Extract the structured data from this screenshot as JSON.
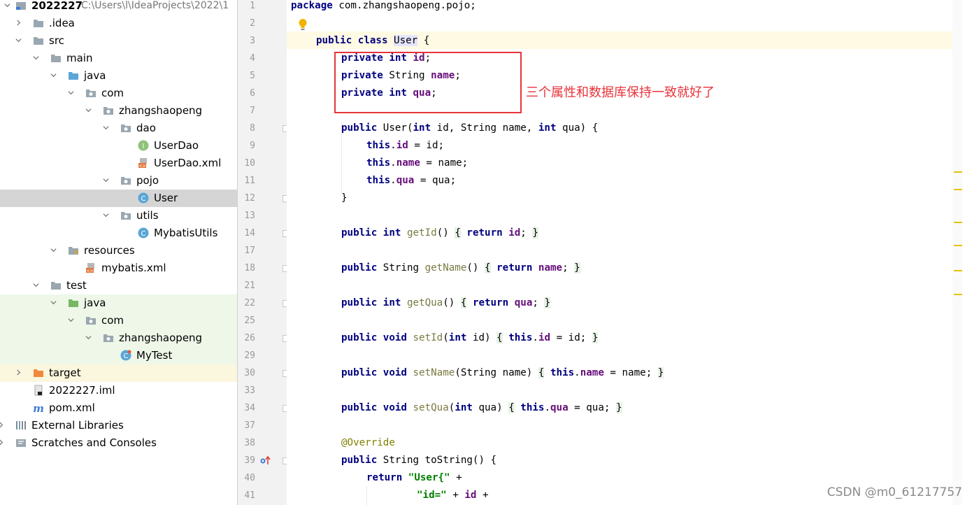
{
  "project_tree": {
    "root": {
      "label": "2022227",
      "path": "C:\\Users\\l\\IdeaProjects\\2022\\1"
    },
    "items": [
      {
        "label": ".idea"
      },
      {
        "label": "src"
      },
      {
        "label": "main"
      },
      {
        "label": "java"
      },
      {
        "label": "com"
      },
      {
        "label": "zhangshaopeng"
      },
      {
        "label": "dao"
      },
      {
        "label": "UserDao"
      },
      {
        "label": "UserDao.xml"
      },
      {
        "label": "pojo"
      },
      {
        "label": "User"
      },
      {
        "label": "utils"
      },
      {
        "label": "MybatisUtils"
      },
      {
        "label": "resources"
      },
      {
        "label": "mybatis.xml"
      },
      {
        "label": "test"
      },
      {
        "label": "java"
      },
      {
        "label": "com"
      },
      {
        "label": "zhangshaopeng"
      },
      {
        "label": "MyTest"
      },
      {
        "label": "target"
      },
      {
        "label": "2022227.iml"
      },
      {
        "label": "pom.xml"
      },
      {
        "label": "External Libraries"
      },
      {
        "label": "Scratches and Consoles"
      }
    ]
  },
  "editor": {
    "line_numbers": [
      "1",
      "2",
      "3",
      "4",
      "5",
      "6",
      "7",
      "8",
      "9",
      "10",
      "11",
      "12",
      "13",
      "14",
      "17",
      "18",
      "21",
      "22",
      "25",
      "26",
      "29",
      "30",
      "33",
      "34",
      "37",
      "38",
      "39",
      "40",
      "41"
    ],
    "code": {
      "l1": {
        "kw": "package",
        "rest": " com.zhangshaopeng.pojo;"
      },
      "l3": {
        "kw1": "public class",
        "name": "User",
        "rest": " {"
      },
      "l4": {
        "kw": "private int",
        "field": "id",
        "end": ";"
      },
      "l5": {
        "kw": "private",
        "type": " String ",
        "field": "name",
        "end": ";"
      },
      "l6": {
        "kw": "private int",
        "field": "qua",
        "end": ";"
      },
      "l8": {
        "kw": "public",
        "a": " User(",
        "k1": "int",
        "b": " id, String name, ",
        "k2": "int",
        "c": " qua) {"
      },
      "l9": {
        "kw": "this",
        "dot": ".",
        "field": "id",
        "rest": " = id;"
      },
      "l10": {
        "kw": "this",
        "dot": ".",
        "field": "name",
        "rest": " = name;"
      },
      "l11": {
        "kw": "this",
        "dot": ".",
        "field": "qua",
        "rest": " = qua;"
      },
      "l12": "}",
      "l14": {
        "kw": "public int",
        "m": "getId",
        "p": "() ",
        "ob": "{",
        "r": "return",
        "f": "id",
        "sc": ";",
        "cb": "}"
      },
      "l18": {
        "kw": "public",
        "t": " String ",
        "m": "getName",
        "p": "() ",
        "ob": "{",
        "r": "return",
        "f": "name",
        "sc": ";",
        "cb": "}"
      },
      "l22": {
        "kw": "public int",
        "m": "getQua",
        "p": "() ",
        "ob": "{",
        "r": "return",
        "f": "qua",
        "sc": ";",
        "cb": "}"
      },
      "l26": {
        "kw": "public void",
        "m": "setId",
        "p1": "(",
        "k": "int",
        "p2": " id) ",
        "ob": "{",
        "th": "this",
        "dot": ".",
        "f": "id",
        "rest": " = id",
        "sc": ";",
        "cb": "}"
      },
      "l30": {
        "kw": "public void",
        "m": "setName",
        "p1": "(String name) ",
        "ob": "{",
        "th": "this",
        "dot": ".",
        "f": "name",
        "rest": " = name",
        "sc": ";",
        "cb": "}"
      },
      "l34": {
        "kw": "public void",
        "m": "setQua",
        "p1": "(",
        "k": "int",
        "p2": " qua) ",
        "ob": "{",
        "th": "this",
        "dot": ".",
        "f": "qua",
        "rest": " = qua",
        "sc": ";",
        "cb": "}"
      },
      "l38": "@Override",
      "l39": {
        "kw": "public",
        "rest": " String toString() {"
      },
      "l40": {
        "kw": "return",
        "str": "\"User{\"",
        "rest": " +"
      },
      "l41": {
        "str": "\"id=\"",
        "mid": " + ",
        "f": "id",
        "rest": " +"
      }
    },
    "annotation_text": "三个属性和数据库保持一致就好了",
    "watermark": "CSDN @m0_61217757"
  },
  "colors": {
    "keyword": "#000080",
    "field": "#660e7a",
    "string": "#008000",
    "annotation_red": "#e8333a",
    "selection": "#d5d5d5"
  }
}
